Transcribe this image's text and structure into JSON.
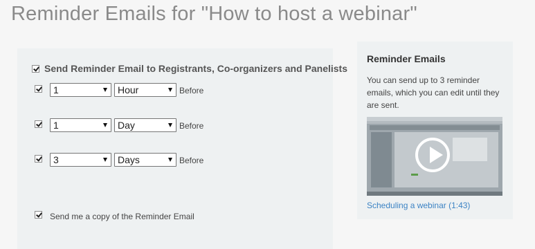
{
  "page": {
    "title": "Reminder Emails for \"How to host a webinar\""
  },
  "reminders": {
    "header_label": "Send Reminder Email to Registrants, Co-organizers and Panelists",
    "header_checked": true,
    "before_label": "Before",
    "rows": [
      {
        "checked": true,
        "amount": "1",
        "unit": "Hour"
      },
      {
        "checked": true,
        "amount": "1",
        "unit": "Day"
      },
      {
        "checked": true,
        "amount": "3",
        "unit": "Days"
      }
    ],
    "copy_label": "Send me a copy of the Reminder Email",
    "copy_checked": true
  },
  "help": {
    "title": "Reminder Emails",
    "description": "You can send up to 3 reminder emails, which you can edit until they are sent.",
    "video_link": "Scheduling a webinar (1:43)",
    "link_color": "#3c83c4"
  }
}
